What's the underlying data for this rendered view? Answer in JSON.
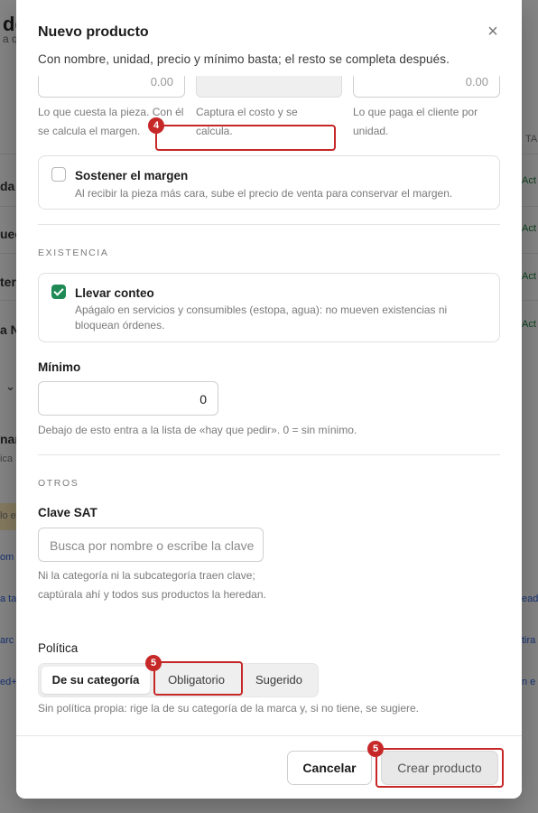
{
  "background": {
    "title": "de",
    "subtitle": "a q",
    "rows": [
      "da",
      "uec",
      "ter",
      "a N"
    ],
    "status_labels": [
      "Act",
      "Act",
      "Act",
      "Act"
    ],
    "right_header": "TAD",
    "left_fragments": [
      "nan",
      "ica",
      "lo e",
      "om",
      "a ta",
      "arc",
      "ed+"
    ],
    "right_fragments": [
      "ead",
      "tira",
      "n e"
    ]
  },
  "modal": {
    "title": "Nuevo producto",
    "description": "Con nombre, unidad, precio y mínimo basta; el resto se completa después.",
    "close_icon": "close-icon",
    "cost_value": "0.00",
    "price_value": "0.00",
    "cost_help": "Lo que cuesta la pieza. Con él se calcula el margen.",
    "margin_help": "Captura el costo y se calcula.",
    "price_help": "Lo que paga el cliente por unidad.",
    "sustain": {
      "title": "Sostener el margen",
      "text": "Al recibir la pieza más cara, sube el precio de venta para conservar el margen."
    },
    "stock_section": "EXISTENCIA",
    "track": {
      "title": "Llevar conteo",
      "text": "Apágalo en servicios y consumibles (estopa, agua): no mueven existencias ni bloquean órdenes."
    },
    "minimum": {
      "label": "Mínimo",
      "value": "0",
      "help": "Debajo de esto entra a la lista de «hay que pedir». 0 = sin mínimo."
    },
    "other_section": "OTROS",
    "sat": {
      "label": "Clave SAT",
      "placeholder": "Busca por nombre o escribe la clave",
      "help": "Ni la categoría ni la subcategoría traen clave; captúrala ahí y todos sus productos la heredan."
    },
    "policy": {
      "label": "Política",
      "options": [
        "De su categoría",
        "Obligatorio",
        "Sugerido"
      ],
      "selected": "De su categoría",
      "help": "Sin política propia: rige la de su categoría de la marca y, si no tiene, se sugiere."
    },
    "annotations": [
      "4",
      "5",
      "5"
    ],
    "cancel_label": "Cancelar",
    "create_label": "Crear producto"
  },
  "colors": {
    "accent_green": "#1f8a55",
    "annotation_red": "#c62828"
  }
}
